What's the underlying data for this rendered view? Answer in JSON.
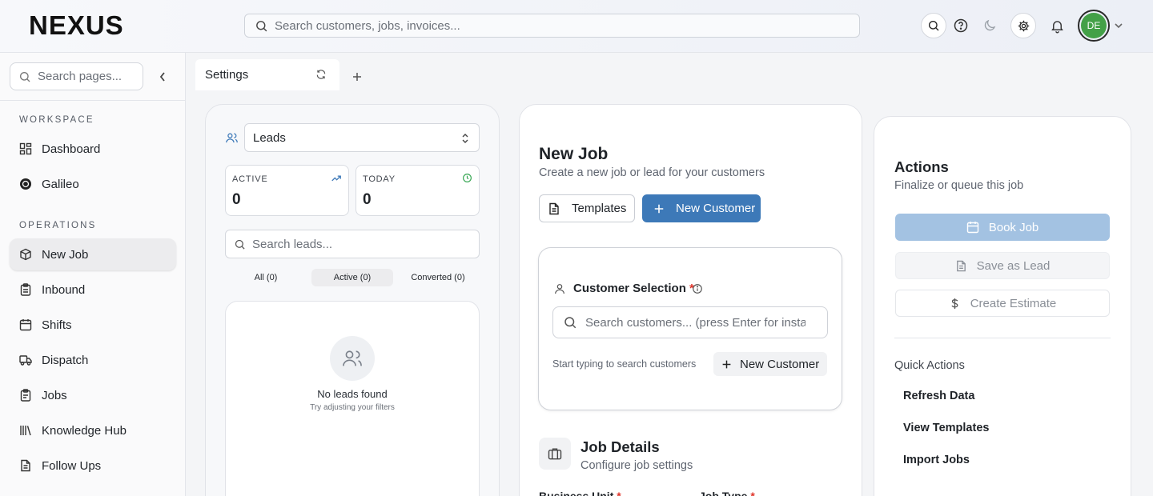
{
  "header": {
    "logo_text": "NEXUS",
    "search_placeholder": "Search customers, jobs, invoices...",
    "avatar_initials": "DE"
  },
  "sidebar": {
    "search_placeholder": "Search pages...",
    "sections": [
      {
        "label": "WORKSPACE",
        "items": [
          "Dashboard",
          "Galileo"
        ]
      },
      {
        "label": "OPERATIONS",
        "items": [
          "New Job",
          "Inbound",
          "Shifts",
          "Dispatch",
          "Jobs",
          "Knowledge Hub",
          "Follow Ups"
        ]
      }
    ],
    "active_item": "New Job"
  },
  "tabs": [
    {
      "label": "Settings"
    }
  ],
  "leads": {
    "selected_view": "Leads",
    "stats": [
      {
        "label": "ACTIVE",
        "value": "0"
      },
      {
        "label": "TODAY",
        "value": "0"
      }
    ],
    "search_placeholder": "Search leads...",
    "filters": [
      "All (0)",
      "Active (0)",
      "Converted (0)"
    ],
    "active_filter": "Active (0)",
    "empty_title": "No leads found",
    "empty_subtitle": "Try adjusting your filters"
  },
  "new_job": {
    "title": "New Job",
    "subtitle": "Create a new job or lead for your customers",
    "templates_label": "Templates",
    "new_customer_label": "New Customer",
    "customer_selection": {
      "label": "Customer Selection",
      "required_mark": "*",
      "search_placeholder": "Search customers... (press Enter for instant search)",
      "hint": "Start typing to search customers",
      "new_customer_label": "New Customer"
    },
    "job_details": {
      "title": "Job Details",
      "subtitle": "Configure job settings",
      "field_1": "Business Unit",
      "field_2": "Job Type"
    }
  },
  "actions": {
    "title": "Actions",
    "subtitle": "Finalize or queue this job",
    "book_job": "Book Job",
    "save_lead": "Save as Lead",
    "create_estimate": "Create Estimate",
    "quick_actions_label": "Quick Actions",
    "quick_actions": [
      "Refresh Data",
      "View Templates",
      "Import Jobs"
    ]
  },
  "colors": {
    "primary": "#3d79b8",
    "primary_disabled": "#a3c2e2",
    "avatar": "#43a047",
    "required": "#e0352b"
  }
}
